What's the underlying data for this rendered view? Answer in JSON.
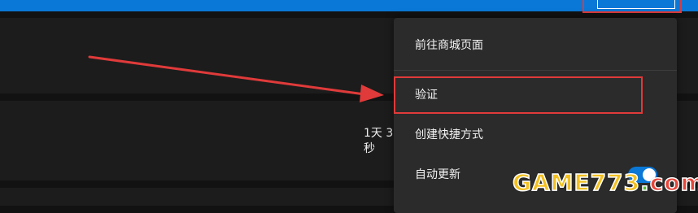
{
  "menu": {
    "items": [
      {
        "label": "前往商城页面"
      },
      {
        "label": "验证"
      },
      {
        "label": "创建快捷方式"
      },
      {
        "label": "自动更新"
      }
    ],
    "auto_update_enabled": true
  },
  "row": {
    "time_line1": "1天 3",
    "time_line2": "秒"
  },
  "watermark": {
    "main": "GAME773",
    "dot": ".",
    "com": "com"
  },
  "colors": {
    "accent_blue": "#0a78d7",
    "highlight_red": "#e03a3a",
    "menu_bg": "#2b2b2b",
    "panel_bg": "#1c1c1c"
  }
}
